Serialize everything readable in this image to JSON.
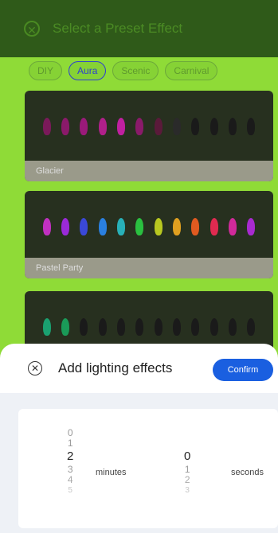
{
  "background": {
    "title": "Select a Preset Effect",
    "chips": [
      {
        "label": "DIY",
        "selected": false
      },
      {
        "label": "Aura",
        "selected": true
      },
      {
        "label": "Scenic",
        "selected": false
      },
      {
        "label": "Carnival",
        "selected": false
      }
    ],
    "cards": [
      {
        "label": "Glacier",
        "bulbs": [
          "#7a1a5a",
          "#8a1a6a",
          "#9a1a7a",
          "#b0208a",
          "#c020a0",
          "#8a1a6a",
          "#5a1a3a",
          "#2a2a2a",
          "#1a1a1a",
          "#1a1a1a",
          "#1a1a1a",
          "#1a1a1a"
        ]
      },
      {
        "label": "Pastel Party",
        "bulbs": [
          "#c030c0",
          "#9a2ad8",
          "#3a48d8",
          "#2a80e0",
          "#28b0b8",
          "#2ac040",
          "#b8c820",
          "#e0a020",
          "#e05a20",
          "#e02a50",
          "#d02a9a",
          "#a82ad0"
        ]
      },
      {
        "label": "",
        "bulbs": [
          "#1aa070",
          "#1a9a58",
          "#1a1a1a",
          "#1a1a1a",
          "#1a1a1a",
          "#1a1a1a",
          "#1a1a1a",
          "#1a1a1a",
          "#1a1a1a",
          "#1a1a1a",
          "#1a1a1a",
          "#1a1a1a"
        ]
      }
    ]
  },
  "sheet": {
    "title": "Add lighting effects",
    "confirm_label": "Confirm",
    "minutes": {
      "above": [
        "0",
        "1"
      ],
      "selected": "2",
      "below": [
        "3",
        "4",
        "5"
      ],
      "unit": "minutes"
    },
    "seconds": {
      "above": [],
      "selected": "0",
      "below": [
        "1",
        "2",
        "3"
      ],
      "unit": "seconds"
    }
  }
}
